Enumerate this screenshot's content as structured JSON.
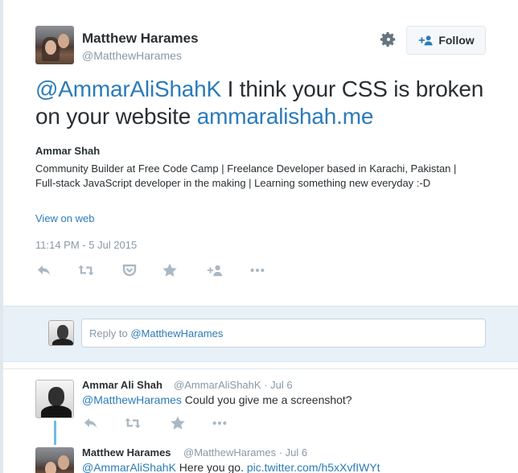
{
  "tweet": {
    "author_name": "Matthew Harames",
    "author_handle": "@MatthewHarames",
    "follow_label": "Follow",
    "text_mention": "@AmmarAliShahK",
    "text_body": " I think your CSS is broken on your website ",
    "text_link": "ammaralishah.me",
    "card": {
      "title": "Ammar Shah",
      "description": "Community Builder at Free Code Camp | Freelance Developer based in Karachi, Pakistan | Full-stack JavaScript developer in the making | Learning something new everyday :-D",
      "view_label": "View on web"
    },
    "timestamp": "11:14 PM - 5 Jul 2015",
    "actions": [
      "reply-icon",
      "retweet-icon",
      "pocket-icon",
      "favorite-icon",
      "follow-user-icon",
      "more-icon"
    ]
  },
  "reply_box": {
    "placeholder_prefix": "Reply to ",
    "placeholder_handle": "@MatthewHarames"
  },
  "replies": [
    {
      "name": "Ammar Ali Shah",
      "handle": "@AmmarAliShahK",
      "date": "Jul 6",
      "mention": "@MatthewHarames",
      "text": " Could you give me a screenshot?"
    },
    {
      "name": "Matthew Harames",
      "handle": "@MatthewHarames",
      "date": "Jul 6",
      "mention": "@AmmarAliShahK",
      "text": " Here you go. ",
      "link": "pic.twitter.com/h5xXvfIWYt"
    }
  ],
  "colors": {
    "accent": "#2b7bb9",
    "muted": "#8899a6",
    "icon": "#aab8c2",
    "thread_line": "#6dbde2"
  }
}
